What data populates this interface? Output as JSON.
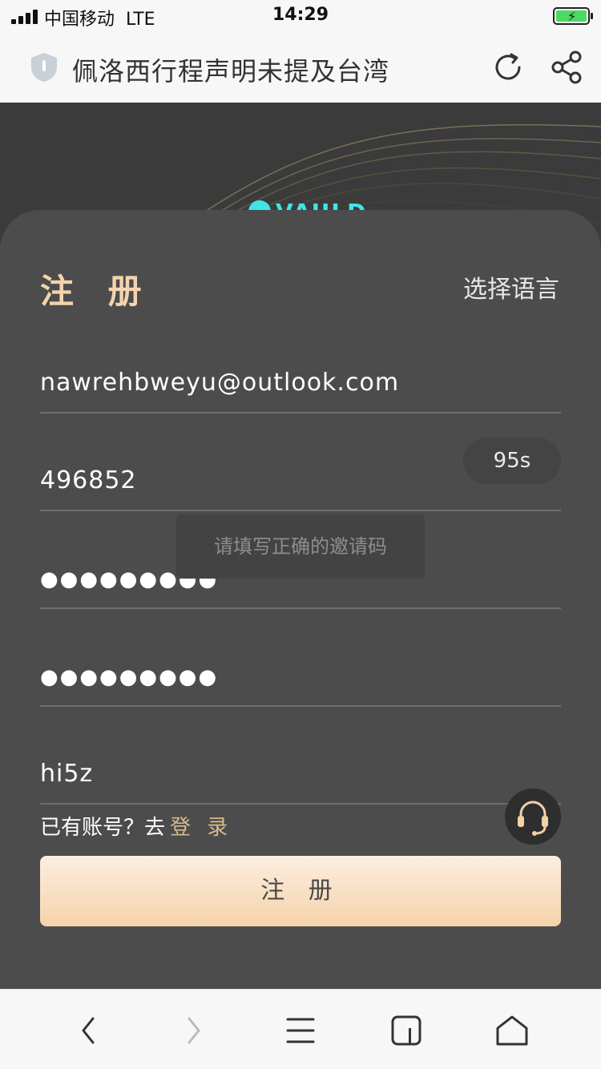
{
  "status_bar": {
    "carrier": "中国移动",
    "network": "LTE",
    "time": "14:29",
    "battery_charging": true
  },
  "browser": {
    "page_title": "佩洛西行程声明未提及台湾",
    "icons": [
      "shield-icon",
      "reload-icon",
      "share-icon"
    ]
  },
  "background": {
    "logo_text": "VAULD"
  },
  "form": {
    "title": "注 册",
    "language_label": "选择语言",
    "email_value": "nawrehbweyu@outlook.com",
    "code_value": "496852",
    "countdown_label": "95s",
    "password_value": "●●●●●●●●●",
    "confirm_password_value": "●●●●●●●●●",
    "invite_code_value": "hi5z",
    "toast_message": "请填写正确的邀请码",
    "login_prompt": "已有账号？去",
    "login_link": "登 录",
    "submit_label": "注 册"
  },
  "bottom_toolbar": {
    "icons": [
      "back-icon",
      "forward-icon",
      "menu-icon",
      "tabs-icon",
      "home-icon"
    ]
  },
  "colors": {
    "accent_gold": "#f4d3ad",
    "link_gold": "#d9b98b",
    "card_bg": "#4c4c4c",
    "page_bg": "#3b3b3b",
    "logo_cyan": "#3ee6e8"
  }
}
